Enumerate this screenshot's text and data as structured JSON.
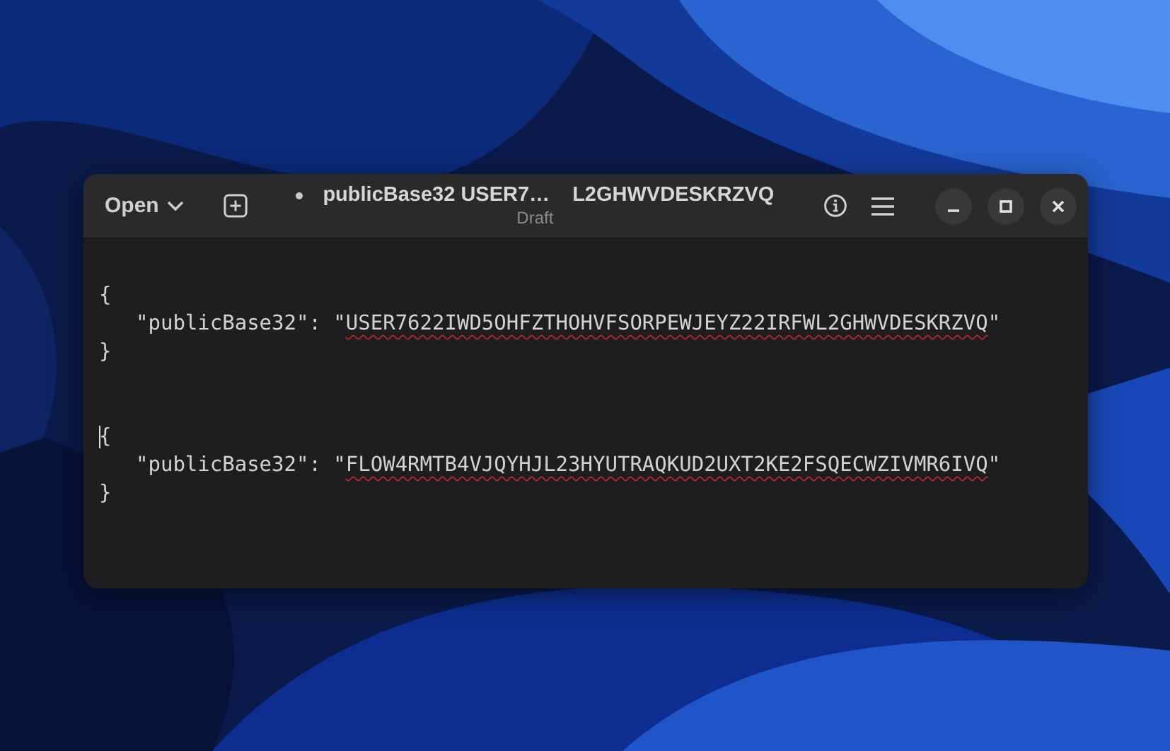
{
  "window": {
    "open_button": "Open",
    "title_start": "publicBase32 USER7…",
    "title_end": "L2GHWVDESKRZVQ",
    "subtitle": "Draft",
    "modified": true
  },
  "editor": {
    "blocks": [
      {
        "open": "{",
        "before": "\"publicBase32\": \"",
        "misspelled": "USER7622IWD5OHFZTHOHVFSORPEWJEYZ22IRFWL2GHWVDESKRZVQ",
        "after": "\"",
        "close": "}",
        "cursor": false
      },
      {
        "open": "{",
        "before": "\"publicBase32\": \"",
        "misspelled": "FLOW4RMTB4VJQYHJL23HYUTRAQKUD2UXT2KE2FSQECWZIVMR6IVQ",
        "after": "\"",
        "close": "}",
        "cursor": true
      }
    ]
  }
}
